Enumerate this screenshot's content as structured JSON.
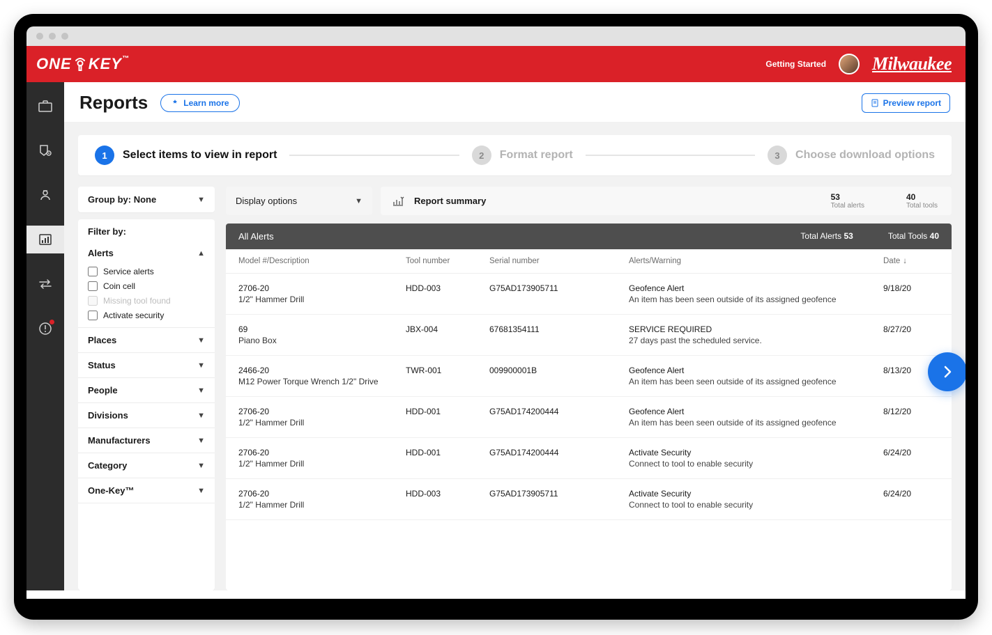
{
  "brand": {
    "app_name": "ONE-KEY",
    "partner": "Milwaukee",
    "getting_started": "Getting Started"
  },
  "page": {
    "title": "Reports",
    "learn_more": "Learn more",
    "preview_report": "Preview report"
  },
  "stepper": {
    "steps": [
      {
        "num": "1",
        "label": "Select items to view in report",
        "active": true
      },
      {
        "num": "2",
        "label": "Format report",
        "active": false
      },
      {
        "num": "3",
        "label": "Choose download options",
        "active": false
      }
    ]
  },
  "filters": {
    "groupby": "Group by: None",
    "filter_by": "Filter by:",
    "sections": [
      {
        "name": "Alerts",
        "open": true,
        "options": [
          {
            "label": "Service alerts",
            "disabled": false
          },
          {
            "label": "Coin cell",
            "disabled": false
          },
          {
            "label": "Missing tool found",
            "disabled": true
          },
          {
            "label": "Activate security",
            "disabled": false
          }
        ]
      },
      {
        "name": "Places",
        "open": false
      },
      {
        "name": "Status",
        "open": false
      },
      {
        "name": "People",
        "open": false
      },
      {
        "name": "Divisions",
        "open": false
      },
      {
        "name": "Manufacturers",
        "open": false
      },
      {
        "name": "Category",
        "open": false
      },
      {
        "name": "One-Key™",
        "open": false
      }
    ]
  },
  "display_options": "Display options",
  "summary": {
    "title": "Report summary",
    "stats": [
      {
        "num": "53",
        "label": "Total alerts"
      },
      {
        "num": "40",
        "label": "Total tools"
      }
    ]
  },
  "section": {
    "title": "All Alerts",
    "alerts_label": "Total Alerts",
    "alerts_value": "53",
    "tools_label": "Total Tools",
    "tools_value": "40"
  },
  "columns": {
    "c1": "Model #/Description",
    "c2": "Tool number",
    "c3": "Serial number",
    "c4": "Alerts/Warning",
    "c5": "Date"
  },
  "rows": [
    {
      "model": "2706-20",
      "desc": "1/2\" Hammer Drill",
      "tool": "HDD-003",
      "serial": "G75AD173905711",
      "alert": "Geofence Alert",
      "alert_desc": "An item has been seen outside of its assigned geofence",
      "date": "9/18/20"
    },
    {
      "model": "69",
      "desc": "Piano Box",
      "tool": "JBX-004",
      "serial": "67681354111",
      "alert": "SERVICE REQUIRED",
      "alert_desc": "27 days past the scheduled service.",
      "date": "8/27/20"
    },
    {
      "model": "2466-20",
      "desc": "M12 Power Torque Wrench 1/2\" Drive",
      "tool": "TWR-001",
      "serial": "009900001B",
      "alert": "Geofence Alert",
      "alert_desc": "An item has been seen outside of its assigned geofence",
      "date": "8/13/20"
    },
    {
      "model": "2706-20",
      "desc": "1/2\" Hammer Drill",
      "tool": "HDD-001",
      "serial": "G75AD174200444",
      "alert": "Geofence Alert",
      "alert_desc": "An item has been seen outside of its assigned geofence",
      "date": "8/12/20"
    },
    {
      "model": "2706-20",
      "desc": "1/2\" Hammer Drill",
      "tool": "HDD-001",
      "serial": "G75AD174200444",
      "alert": "Activate Security",
      "alert_desc": "Connect to tool to enable security",
      "date": "6/24/20"
    },
    {
      "model": "2706-20",
      "desc": "1/2\" Hammer Drill",
      "tool": "HDD-003",
      "serial": "G75AD173905711",
      "alert": "Activate Security",
      "alert_desc": "Connect to tool to enable security",
      "date": "6/24/20"
    }
  ],
  "sidenav": [
    {
      "name": "inventory",
      "icon": "briefcase"
    },
    {
      "name": "places",
      "icon": "shield-location"
    },
    {
      "name": "people",
      "icon": "person"
    },
    {
      "name": "reports",
      "icon": "bar-chart",
      "active": true
    },
    {
      "name": "transfers",
      "icon": "arrows"
    },
    {
      "name": "alerts",
      "icon": "alert",
      "badge": true
    }
  ]
}
